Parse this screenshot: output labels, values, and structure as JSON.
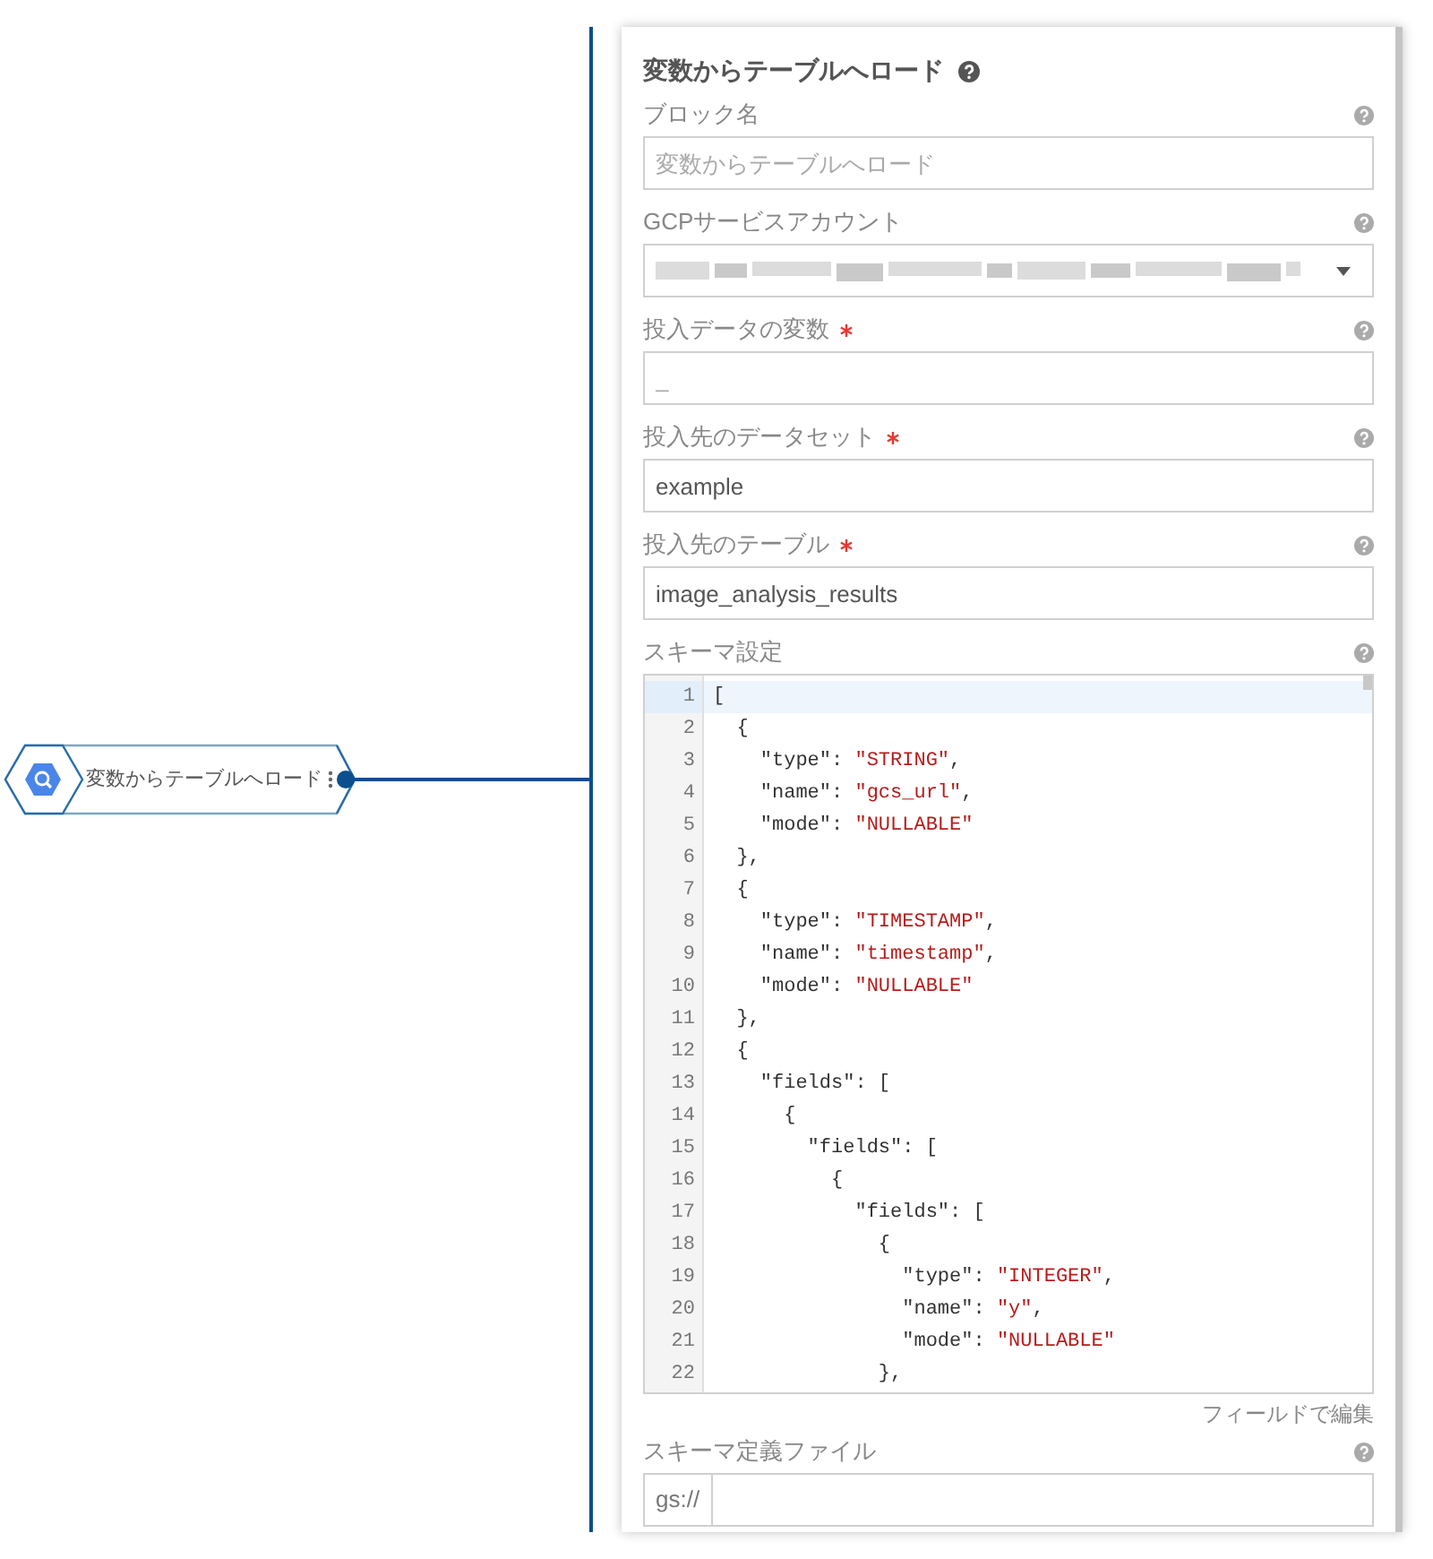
{
  "node": {
    "label": "変数からテーブルへロード"
  },
  "panel": {
    "title": "変数からテーブルへロード",
    "fields": [
      {
        "kind": "text",
        "label": "ブロック名",
        "required": false,
        "placeholder": "変数からテーブルへロード"
      },
      {
        "kind": "select",
        "label": "GCPサービスアカウント",
        "required": false,
        "value_redacted": true
      },
      {
        "kind": "text",
        "label": "投入データの変数",
        "required": true,
        "placeholder": "_"
      },
      {
        "kind": "text",
        "label": "投入先のデータセット",
        "required": true,
        "value": "example"
      },
      {
        "kind": "text",
        "label": "投入先のテーブル",
        "required": true,
        "value": "image_analysis_results"
      },
      {
        "kind": "code",
        "label": "スキーマ設定",
        "required": false,
        "link": "フィールドで編集",
        "lines": [
          {
            "number": "1",
            "active": true,
            "code": [
              {
                "kind": "plain",
                "text": "["
              }
            ]
          },
          {
            "number": "2",
            "active": false,
            "code": [
              {
                "kind": "plain",
                "text": "  {"
              }
            ]
          },
          {
            "number": "3",
            "active": false,
            "code": [
              {
                "kind": "plain",
                "text": "    \"type\": "
              },
              {
                "kind": "string",
                "text": "\"STRING\""
              },
              {
                "kind": "plain",
                "text": ","
              }
            ]
          },
          {
            "number": "4",
            "active": false,
            "code": [
              {
                "kind": "plain",
                "text": "    \"name\": "
              },
              {
                "kind": "string",
                "text": "\"gcs_url\""
              },
              {
                "kind": "plain",
                "text": ","
              }
            ]
          },
          {
            "number": "5",
            "active": false,
            "code": [
              {
                "kind": "plain",
                "text": "    \"mode\": "
              },
              {
                "kind": "string",
                "text": "\"NULLABLE\""
              }
            ]
          },
          {
            "number": "6",
            "active": false,
            "code": [
              {
                "kind": "plain",
                "text": "  },"
              }
            ]
          },
          {
            "number": "7",
            "active": false,
            "code": [
              {
                "kind": "plain",
                "text": "  {"
              }
            ]
          },
          {
            "number": "8",
            "active": false,
            "code": [
              {
                "kind": "plain",
                "text": "    \"type\": "
              },
              {
                "kind": "string",
                "text": "\"TIMESTAMP\""
              },
              {
                "kind": "plain",
                "text": ","
              }
            ]
          },
          {
            "number": "9",
            "active": false,
            "code": [
              {
                "kind": "plain",
                "text": "    \"name\": "
              },
              {
                "kind": "string",
                "text": "\"timestamp\""
              },
              {
                "kind": "plain",
                "text": ","
              }
            ]
          },
          {
            "number": "10",
            "active": false,
            "code": [
              {
                "kind": "plain",
                "text": "    \"mode\": "
              },
              {
                "kind": "string",
                "text": "\"NULLABLE\""
              }
            ]
          },
          {
            "number": "11",
            "active": false,
            "code": [
              {
                "kind": "plain",
                "text": "  },"
              }
            ]
          },
          {
            "number": "12",
            "active": false,
            "code": [
              {
                "kind": "plain",
                "text": "  {"
              }
            ]
          },
          {
            "number": "13",
            "active": false,
            "code": [
              {
                "kind": "plain",
                "text": "    \"fields\": ["
              }
            ]
          },
          {
            "number": "14",
            "active": false,
            "code": [
              {
                "kind": "plain",
                "text": "      {"
              }
            ]
          },
          {
            "number": "15",
            "active": false,
            "code": [
              {
                "kind": "plain",
                "text": "        \"fields\": ["
              }
            ]
          },
          {
            "number": "16",
            "active": false,
            "code": [
              {
                "kind": "plain",
                "text": "          {"
              }
            ]
          },
          {
            "number": "17",
            "active": false,
            "code": [
              {
                "kind": "plain",
                "text": "            \"fields\": ["
              }
            ]
          },
          {
            "number": "18",
            "active": false,
            "code": [
              {
                "kind": "plain",
                "text": "              {"
              }
            ]
          },
          {
            "number": "19",
            "active": false,
            "code": [
              {
                "kind": "plain",
                "text": "                \"type\": "
              },
              {
                "kind": "string",
                "text": "\"INTEGER\""
              },
              {
                "kind": "plain",
                "text": ","
              }
            ]
          },
          {
            "number": "20",
            "active": false,
            "code": [
              {
                "kind": "plain",
                "text": "                \"name\": "
              },
              {
                "kind": "string",
                "text": "\"y\""
              },
              {
                "kind": "plain",
                "text": ","
              }
            ]
          },
          {
            "number": "21",
            "active": false,
            "code": [
              {
                "kind": "plain",
                "text": "                \"mode\": "
              },
              {
                "kind": "string",
                "text": "\"NULLABLE\""
              }
            ]
          },
          {
            "number": "22",
            "active": false,
            "code": [
              {
                "kind": "plain",
                "text": "              },"
              }
            ]
          }
        ]
      },
      {
        "kind": "prefixed",
        "label": "スキーマ定義ファイル",
        "required": false,
        "prefix": "gs://"
      }
    ]
  }
}
